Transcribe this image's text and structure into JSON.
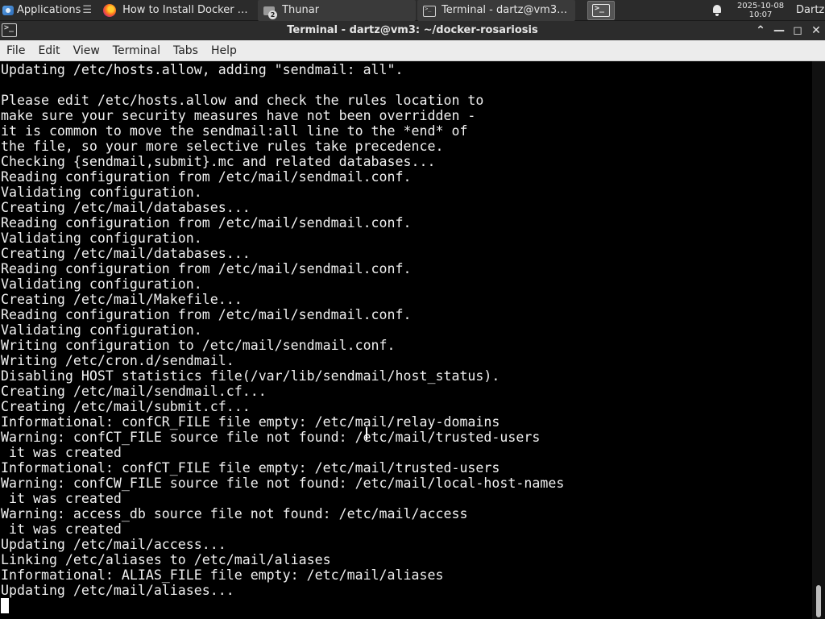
{
  "panel": {
    "applications_label": "Applications",
    "separator_glyph": "☰",
    "tasks": [
      {
        "label": "How to Install Docker o...",
        "icon": "firefox-icon"
      },
      {
        "label": "Thunar",
        "icon": "folder-icon",
        "badge": "2"
      },
      {
        "label": "Terminal - dartz@vm3: ...",
        "icon": "terminal-icon"
      }
    ],
    "clock_date": "2025-10-08",
    "clock_time": "10:07",
    "user": "Dartz"
  },
  "window": {
    "title": "Terminal - dartz@vm3: ~/docker-rosariosis",
    "controls": {
      "up": "⌃",
      "minimize": "—",
      "maximize": "◻",
      "close": "✕"
    }
  },
  "menubar": {
    "items": [
      "File",
      "Edit",
      "View",
      "Terminal",
      "Tabs",
      "Help"
    ]
  },
  "terminal": {
    "lines": [
      "Updating /etc/hosts.allow, adding \"sendmail: all\".",
      "",
      "Please edit /etc/hosts.allow and check the rules location to",
      "make sure your security measures have not been overridden -",
      "it is common to move the sendmail:all line to the *end* of",
      "the file, so your more selective rules take precedence.",
      "Checking {sendmail,submit}.mc and related databases...",
      "Reading configuration from /etc/mail/sendmail.conf.",
      "Validating configuration.",
      "Creating /etc/mail/databases...",
      "Reading configuration from /etc/mail/sendmail.conf.",
      "Validating configuration.",
      "Creating /etc/mail/databases...",
      "Reading configuration from /etc/mail/sendmail.conf.",
      "Validating configuration.",
      "Creating /etc/mail/Makefile...",
      "Reading configuration from /etc/mail/sendmail.conf.",
      "Validating configuration.",
      "Writing configuration to /etc/mail/sendmail.conf.",
      "Writing /etc/cron.d/sendmail.",
      "Disabling HOST statistics file(/var/lib/sendmail/host_status).",
      "Creating /etc/mail/sendmail.cf...",
      "Creating /etc/mail/submit.cf...",
      "Informational: confCR_FILE file empty: /etc/mail/relay-domains",
      "Warning: confCT_FILE source file not found: /etc/mail/trusted-users",
      " it was created",
      "Informational: confCT_FILE file empty: /etc/mail/trusted-users",
      "Warning: confCW_FILE source file not found: /etc/mail/local-host-names",
      " it was created",
      "Warning: access_db source file not found: /etc/mail/access",
      " it was created",
      "Updating /etc/mail/access...",
      "Linking /etc/aliases to /etc/mail/aliases",
      "Informational: ALIAS_FILE file empty: /etc/mail/aliases",
      "Updating /etc/mail/aliases..."
    ]
  },
  "colors": {
    "panel_bg": "#2b2b2b",
    "titlebar_bg": "#2c2c2c",
    "menubar_bg": "#ececec",
    "terminal_bg": "#000000",
    "terminal_fg": "#f0f0f0"
  }
}
